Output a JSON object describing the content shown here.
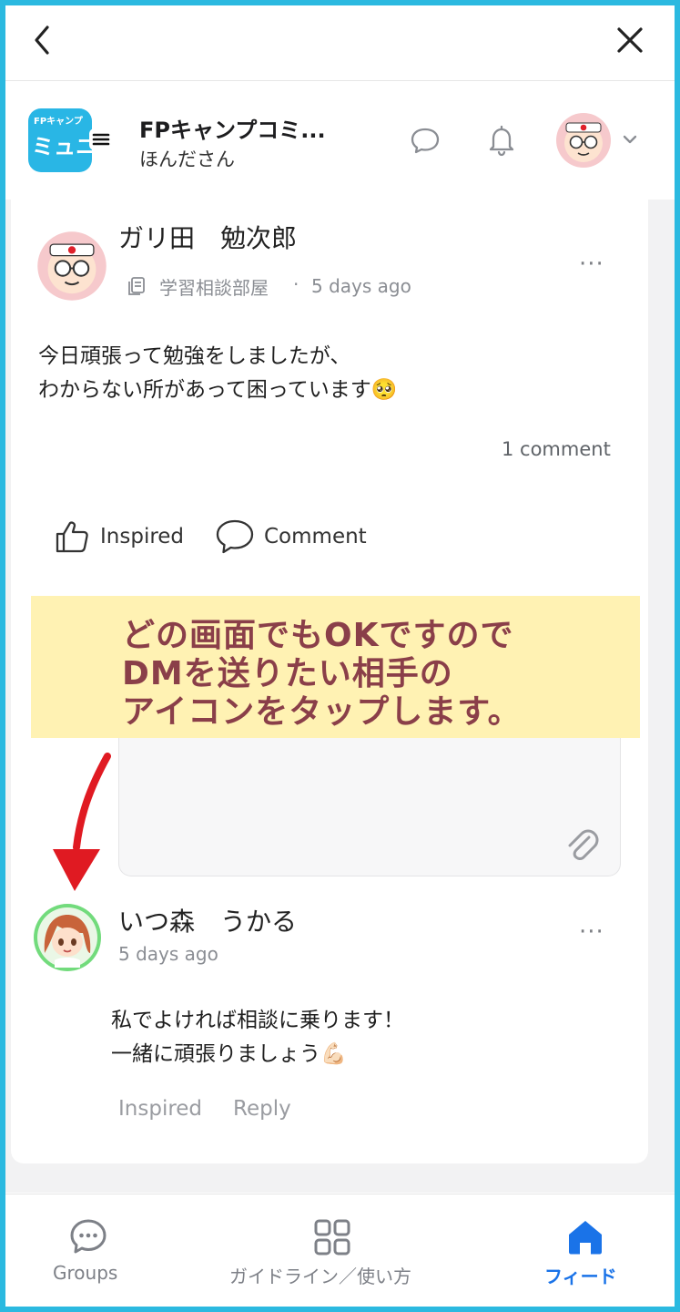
{
  "window": {
    "back_label": "<",
    "close_label": "×"
  },
  "community": {
    "logo_top": "FPキャンプ",
    "logo_main": "ミュニ",
    "name": "FPキャンプコミ...",
    "subtitle": "ほんださん"
  },
  "post": {
    "author": "ガリ田　勉次郎",
    "space": "学習相談部屋",
    "separator": "·",
    "time": "5 days ago",
    "body_line1": "今日頑張って勉強をしましたが、",
    "body_line2": "わからない所があって困っています🥺",
    "comments_count": "1 comment",
    "inspired_label": "Inspired",
    "comment_label": "Comment",
    "more_label": "···"
  },
  "overlay": {
    "line1": "どの画面でもOKですので",
    "line2": "DMを送りたい相手の",
    "line3": "アイコンをタップします。",
    "bg_color": "#fff2b3",
    "text_color": "#8a3f49",
    "arrow_color": "#e01a22"
  },
  "comment": {
    "author": "いつ森　うかる",
    "time": "5 days ago",
    "body_line1": "私でよければ相談に乗ります！",
    "body_line2": "一緒に頑張りましょう💪🏻",
    "inspired_label": "Inspired",
    "reply_label": "Reply",
    "more_label": "···"
  },
  "bottom_nav": [
    {
      "label": "Groups",
      "icon": "chat-bubble-icon",
      "active": false
    },
    {
      "label": "ガイドライン／使い方",
      "icon": "grid-icon",
      "active": false
    },
    {
      "label": "フィード",
      "icon": "home-icon",
      "active": true
    }
  ],
  "colors": {
    "frame": "#2bb9e0",
    "accent": "#1a73e8",
    "logo_bg": "#29b6e5"
  }
}
